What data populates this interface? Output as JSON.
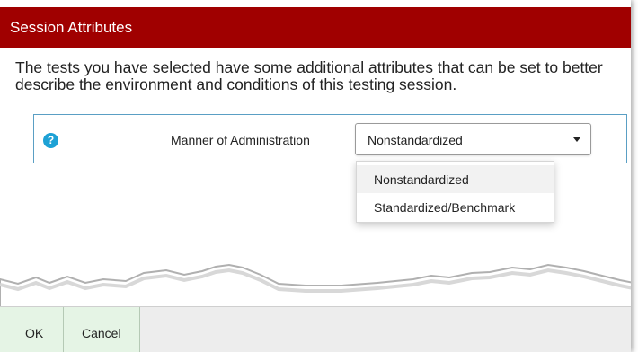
{
  "dialog": {
    "title": "Session Attributes",
    "description": "The tests you have selected have some additional attributes that can be set to better describe the environment and conditions of this testing session.",
    "colors": {
      "title_bar": "#a00000",
      "help_icon": "#1da1d5",
      "button_bg": "#e5f4e5"
    }
  },
  "attribute": {
    "help_icon": "question-circle-icon",
    "help_glyph": "?",
    "label": "Manner of Administration",
    "selected": "Nonstandardized",
    "options": [
      "Nonstandardized",
      "Standardized/Benchmark"
    ]
  },
  "buttons": {
    "ok": "OK",
    "cancel": "Cancel"
  }
}
